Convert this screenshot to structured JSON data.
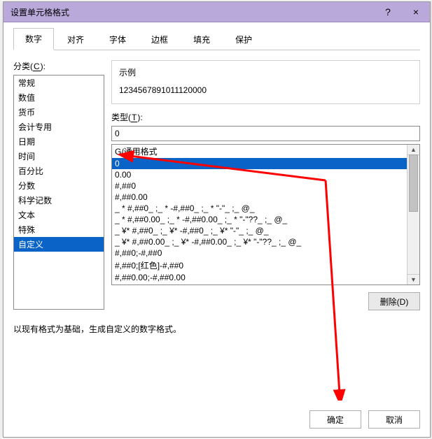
{
  "title": "设置单元格格式",
  "titlebar": {
    "help": "?",
    "close": "×"
  },
  "tabs": [
    {
      "label": "数字",
      "active": true
    },
    {
      "label": "对齐"
    },
    {
      "label": "字体"
    },
    {
      "label": "边框"
    },
    {
      "label": "填充"
    },
    {
      "label": "保护"
    }
  ],
  "category": {
    "label_text": "分类(",
    "label_accel": "C",
    "label_tail": "):",
    "items": [
      "常规",
      "数值",
      "货币",
      "会计专用",
      "日期",
      "时间",
      "百分比",
      "分数",
      "科学记数",
      "文本",
      "特殊",
      "自定义"
    ],
    "selected_index": 11
  },
  "sample": {
    "label": "示例",
    "value": "1234567891011120000"
  },
  "type": {
    "label_text": "类型(",
    "label_accel": "T",
    "label_tail": "):",
    "value": "0",
    "items": [
      "G/通用格式",
      "0",
      "0.00",
      "#,##0",
      "#,##0.00",
      "_ * #,##0_ ;_ * -#,##0_ ;_ * \"-\"_ ;_ @_ ",
      "_ * #,##0.00_ ;_ * -#,##0.00_ ;_ * \"-\"??_ ;_ @_ ",
      "_ ¥* #,##0_ ;_ ¥* -#,##0_ ;_ ¥* \"-\"_ ;_ @_ ",
      "_ ¥* #,##0.00_ ;_ ¥* -#,##0.00_ ;_ ¥* \"-\"??_ ;_ @_ ",
      "#,##0;-#,##0",
      "#,##0;[红色]-#,##0",
      "#,##0.00;-#,##0.00"
    ],
    "selected_index": 1
  },
  "delete_btn": "删除(D)",
  "hint": "以现有格式为基础，生成自定义的数字格式。",
  "footer": {
    "ok": "确定",
    "cancel": "取消"
  },
  "chart_data": null
}
